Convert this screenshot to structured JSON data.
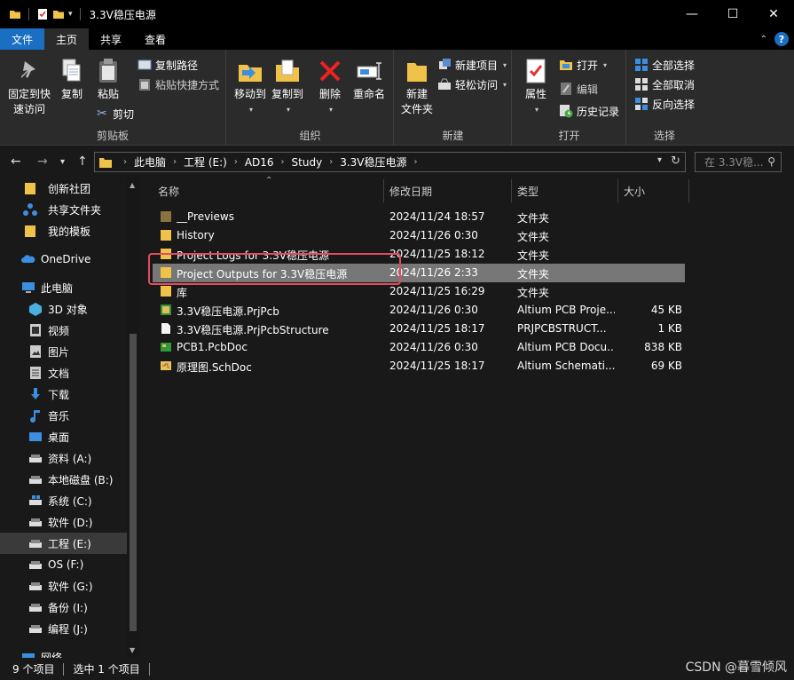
{
  "window": {
    "title": "3.3V稳压电源",
    "minimize": "—",
    "maximize": "☐",
    "close": "✕"
  },
  "tabs": [
    {
      "label": "文件"
    },
    {
      "label": "主页"
    },
    {
      "label": "共享"
    },
    {
      "label": "查看"
    }
  ],
  "ribbon": {
    "clipboard": {
      "label": "剪贴板",
      "pin": "固定到快\n速访问",
      "copy": "复制",
      "paste": "粘贴",
      "copy_path": "复制路径",
      "paste_shortcut": "粘贴快捷方式",
      "cut": "剪切"
    },
    "organize": {
      "label": "组织",
      "move_to": "移动到",
      "copy_to": "复制到",
      "delete": "删除",
      "rename": "重命名"
    },
    "new": {
      "label": "新建",
      "new_folder": "新建\n文件夹",
      "new_item": "新建项目",
      "easy_access": "轻松访问"
    },
    "open": {
      "label": "打开",
      "properties": "属性",
      "open": "打开",
      "edit": "编辑",
      "history": "历史记录"
    },
    "select": {
      "label": "选择",
      "select_all": "全部选择",
      "select_none": "全部取消",
      "invert": "反向选择"
    }
  },
  "address": {
    "crumbs": [
      "此电脑",
      "工程 (E:)",
      "AD16",
      "Study",
      "3.3V稳压电源"
    ],
    "search_placeholder": "在 3.3V稳..."
  },
  "nav": {
    "items": [
      {
        "label": "创新社团",
        "icon": "folder"
      },
      {
        "label": "共享文件夹",
        "icon": "network-share"
      },
      {
        "label": "我的模板",
        "icon": "folder"
      },
      {
        "label": "OneDrive",
        "icon": "cloud"
      },
      {
        "label": "此电脑",
        "icon": "computer"
      },
      {
        "label": "3D 对象",
        "icon": "3d-objects"
      },
      {
        "label": "视频",
        "icon": "video"
      },
      {
        "label": "图片",
        "icon": "pictures"
      },
      {
        "label": "文档",
        "icon": "documents"
      },
      {
        "label": "下载",
        "icon": "downloads"
      },
      {
        "label": "音乐",
        "icon": "music"
      },
      {
        "label": "桌面",
        "icon": "desktop"
      },
      {
        "label": "资料 (A:)",
        "icon": "drive"
      },
      {
        "label": "本地磁盘 (B:)",
        "icon": "drive"
      },
      {
        "label": "系统 (C:)",
        "icon": "drive"
      },
      {
        "label": "软件 (D:)",
        "icon": "drive"
      },
      {
        "label": "工程 (E:)",
        "icon": "drive"
      },
      {
        "label": "OS (F:)",
        "icon": "drive"
      },
      {
        "label": "软件 (G:)",
        "icon": "drive"
      },
      {
        "label": "备份 (I:)",
        "icon": "drive"
      },
      {
        "label": "编程 (J:)",
        "icon": "drive"
      },
      {
        "label": "网络",
        "icon": "network"
      }
    ]
  },
  "columns": {
    "name": "名称",
    "date": "修改日期",
    "type": "类型",
    "size": "大小"
  },
  "files": [
    {
      "name": "__Previews",
      "date": "2024/11/24 18:57",
      "type": "文件夹",
      "size": "",
      "icon": "folder-dark"
    },
    {
      "name": "History",
      "date": "2024/11/26 0:30",
      "type": "文件夹",
      "size": "",
      "icon": "folder"
    },
    {
      "name": "Project Logs for 3.3V稳压电源",
      "date": "2024/11/25 18:12",
      "type": "文件夹",
      "size": "",
      "icon": "folder"
    },
    {
      "name": "Project Outputs for 3.3V稳压电源",
      "date": "2024/11/26 2:33",
      "type": "文件夹",
      "size": "",
      "icon": "folder"
    },
    {
      "name": "库",
      "date": "2024/11/25 16:29",
      "type": "文件夹",
      "size": "",
      "icon": "folder"
    },
    {
      "name": "3.3V稳压电源.PrjPcb",
      "date": "2024/11/26 0:30",
      "type": "Altium PCB Proje...",
      "size": "45 KB",
      "icon": "prjpcb"
    },
    {
      "name": "3.3V稳压电源.PrjPcbStructure",
      "date": "2024/11/25 18:17",
      "type": "PRJPCBSTRUCT...",
      "size": "1 KB",
      "icon": "file"
    },
    {
      "name": "PCB1.PcbDoc",
      "date": "2024/11/26 0:30",
      "type": "Altium PCB Docu...",
      "size": "838 KB",
      "icon": "pcbdoc"
    },
    {
      "name": "原理图.SchDoc",
      "date": "2024/11/25 18:17",
      "type": "Altium Schemati...",
      "size": "69 KB",
      "icon": "schdoc"
    }
  ],
  "status": {
    "count": "9 个项目",
    "selected": "选中 1 个项目"
  },
  "watermark": "CSDN @暮雪倾风",
  "colors": {
    "accent": "#1a6fc3",
    "highlight_box": "#e54b5f",
    "folder": "#f0c24a"
  }
}
